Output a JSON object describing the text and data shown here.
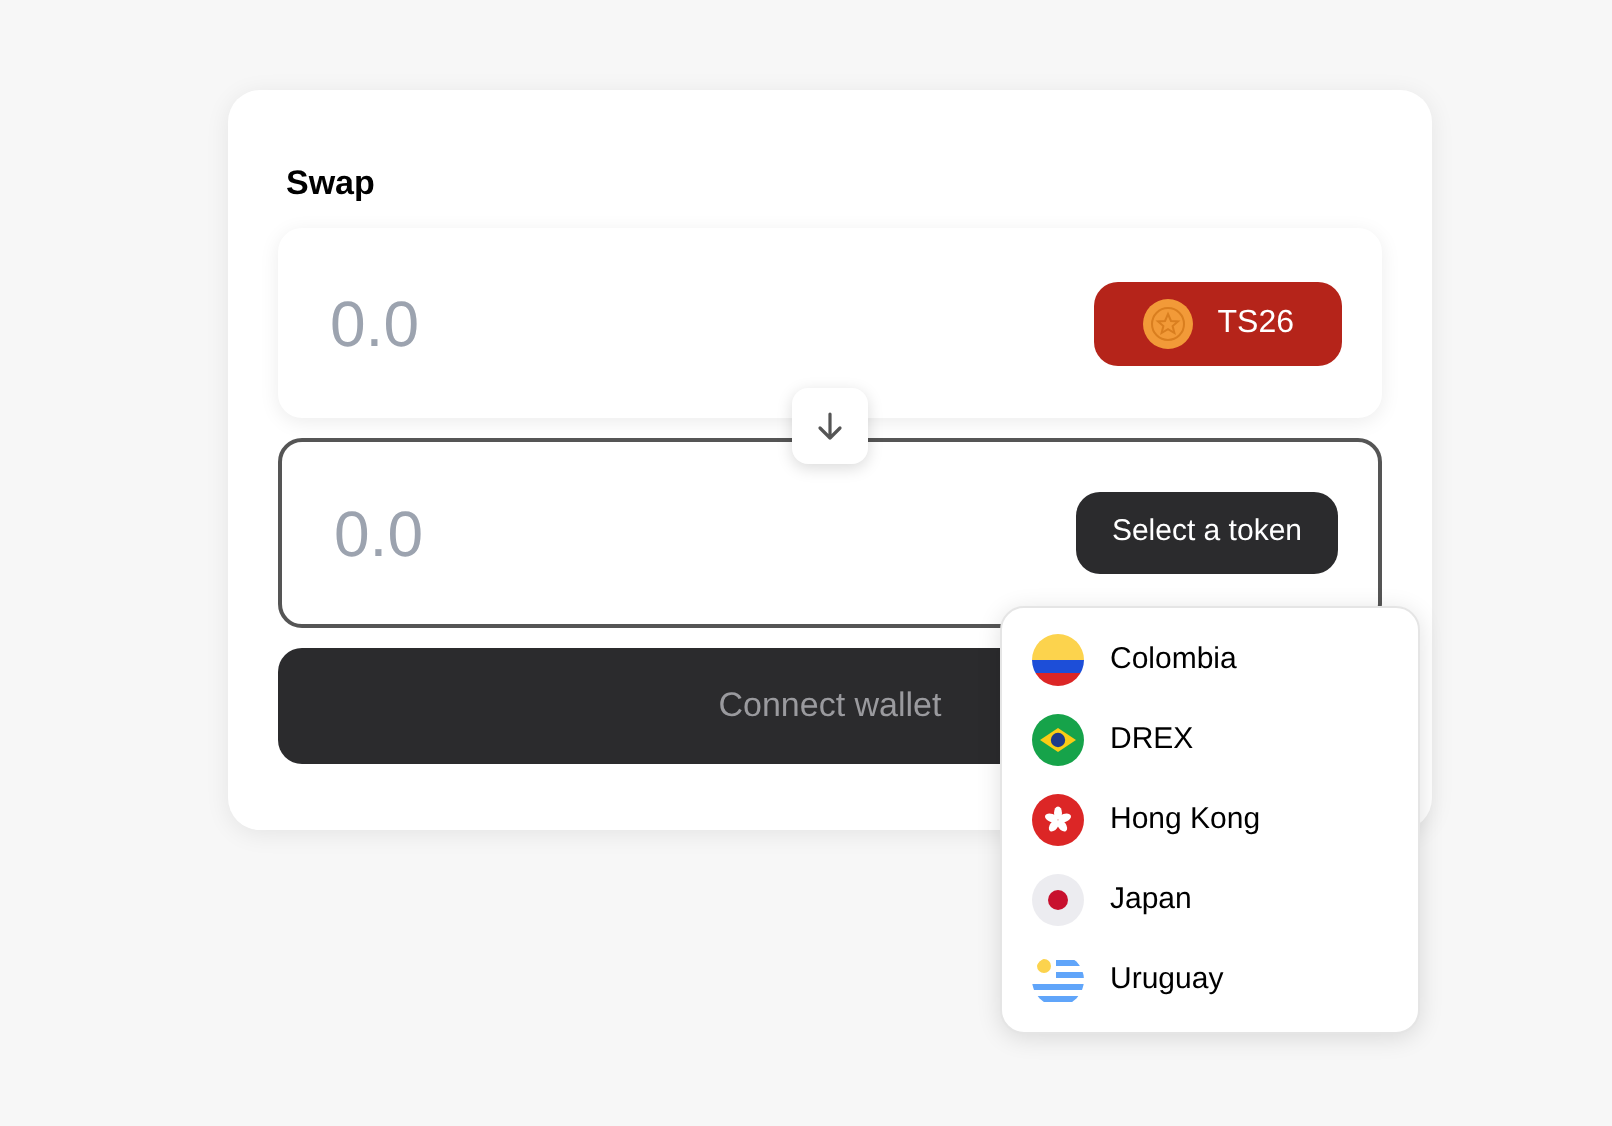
{
  "title": "Swap",
  "inputs": [
    {
      "placeholder": "0.0",
      "focused": false,
      "token": {
        "kind": "selected",
        "label": "TS26"
      }
    },
    {
      "placeholder": "0.0",
      "focused": true,
      "token": {
        "kind": "select",
        "label": "Select a token"
      }
    }
  ],
  "connect_button": {
    "label": "Connect wallet",
    "disabled": true
  },
  "token_menu": [
    {
      "label": "Colombia",
      "kind": "colombia"
    },
    {
      "label": "DREX",
      "kind": "brazil"
    },
    {
      "label": "Hong Kong",
      "kind": "hongkong"
    },
    {
      "label": "Japan",
      "kind": "japan"
    },
    {
      "label": "Uruguay",
      "kind": "uruguay"
    }
  ]
}
